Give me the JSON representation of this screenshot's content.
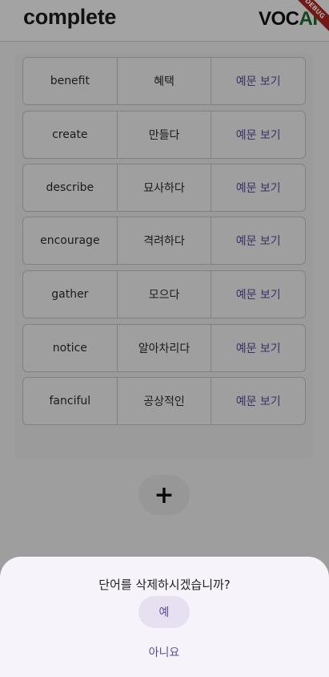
{
  "app_bar": {
    "title": "complete",
    "logo_left": "VOC",
    "logo_right": "AI",
    "debug_banner": "DEBUG"
  },
  "words": [
    {
      "word": "benefit",
      "meaning": "혜택",
      "action": "예문 보기"
    },
    {
      "word": "create",
      "meaning": "만들다",
      "action": "예문 보기"
    },
    {
      "word": "describe",
      "meaning": "묘사하다",
      "action": "예문 보기"
    },
    {
      "word": "encourage",
      "meaning": "격려하다",
      "action": "예문 보기"
    },
    {
      "word": "gather",
      "meaning": "모으다",
      "action": "예문 보기"
    },
    {
      "word": "notice",
      "meaning": "알아차리다",
      "action": "예문 보기"
    },
    {
      "word": "fanciful",
      "meaning": "공상적인",
      "action": "예문 보기"
    }
  ],
  "fab": {
    "label": "+"
  },
  "dialog": {
    "message": "단어를 삭제하시겠습니까?",
    "confirm_label": "예",
    "cancel_label": "아니요"
  },
  "colors": {
    "accent": "#5b4d9c",
    "logo_ai": "#1d6e2a",
    "confirm_bg": "#e7e0f1"
  }
}
